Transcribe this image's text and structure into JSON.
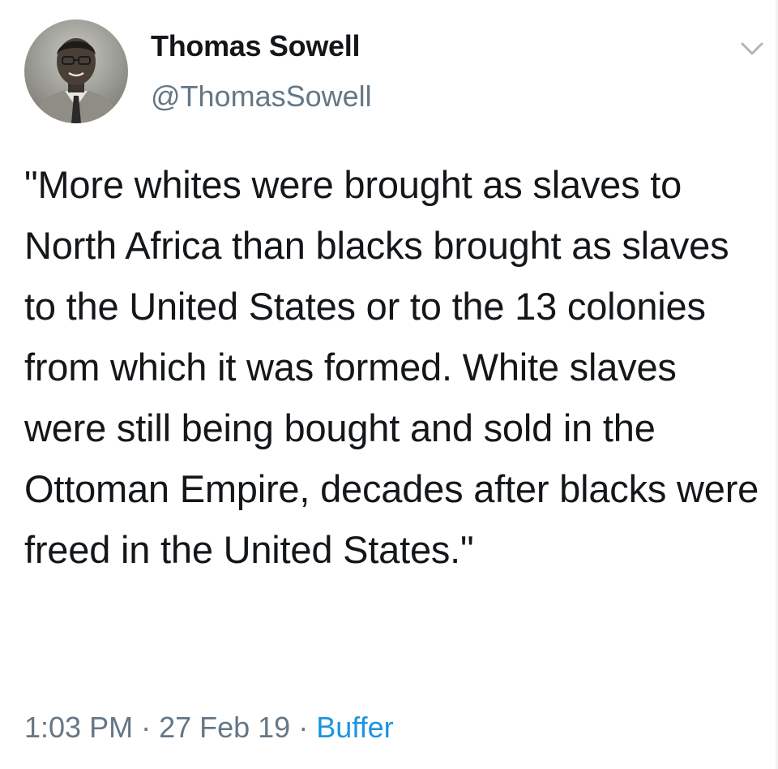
{
  "tweet": {
    "display_name": "Thomas Sowell",
    "handle": "@ThomasSowell",
    "text": "\"More whites were brought as slaves to North Africa than blacks brought as slaves to the United States or to the 13 colonies from which it was formed. White slaves were still being bought and sold in the Ottoman Empire, decades after blacks were freed in the United States.\"",
    "time": "1:03 PM",
    "date": "27 Feb 19",
    "source": "Buffer",
    "separator": "·",
    "avatar_icon": "profile-photo",
    "menu_icon": "chevron-down-icon"
  },
  "colors": {
    "text": "#14171a",
    "secondary": "#657786",
    "link": "#1b95e0",
    "chevron": "#aab8c2"
  }
}
